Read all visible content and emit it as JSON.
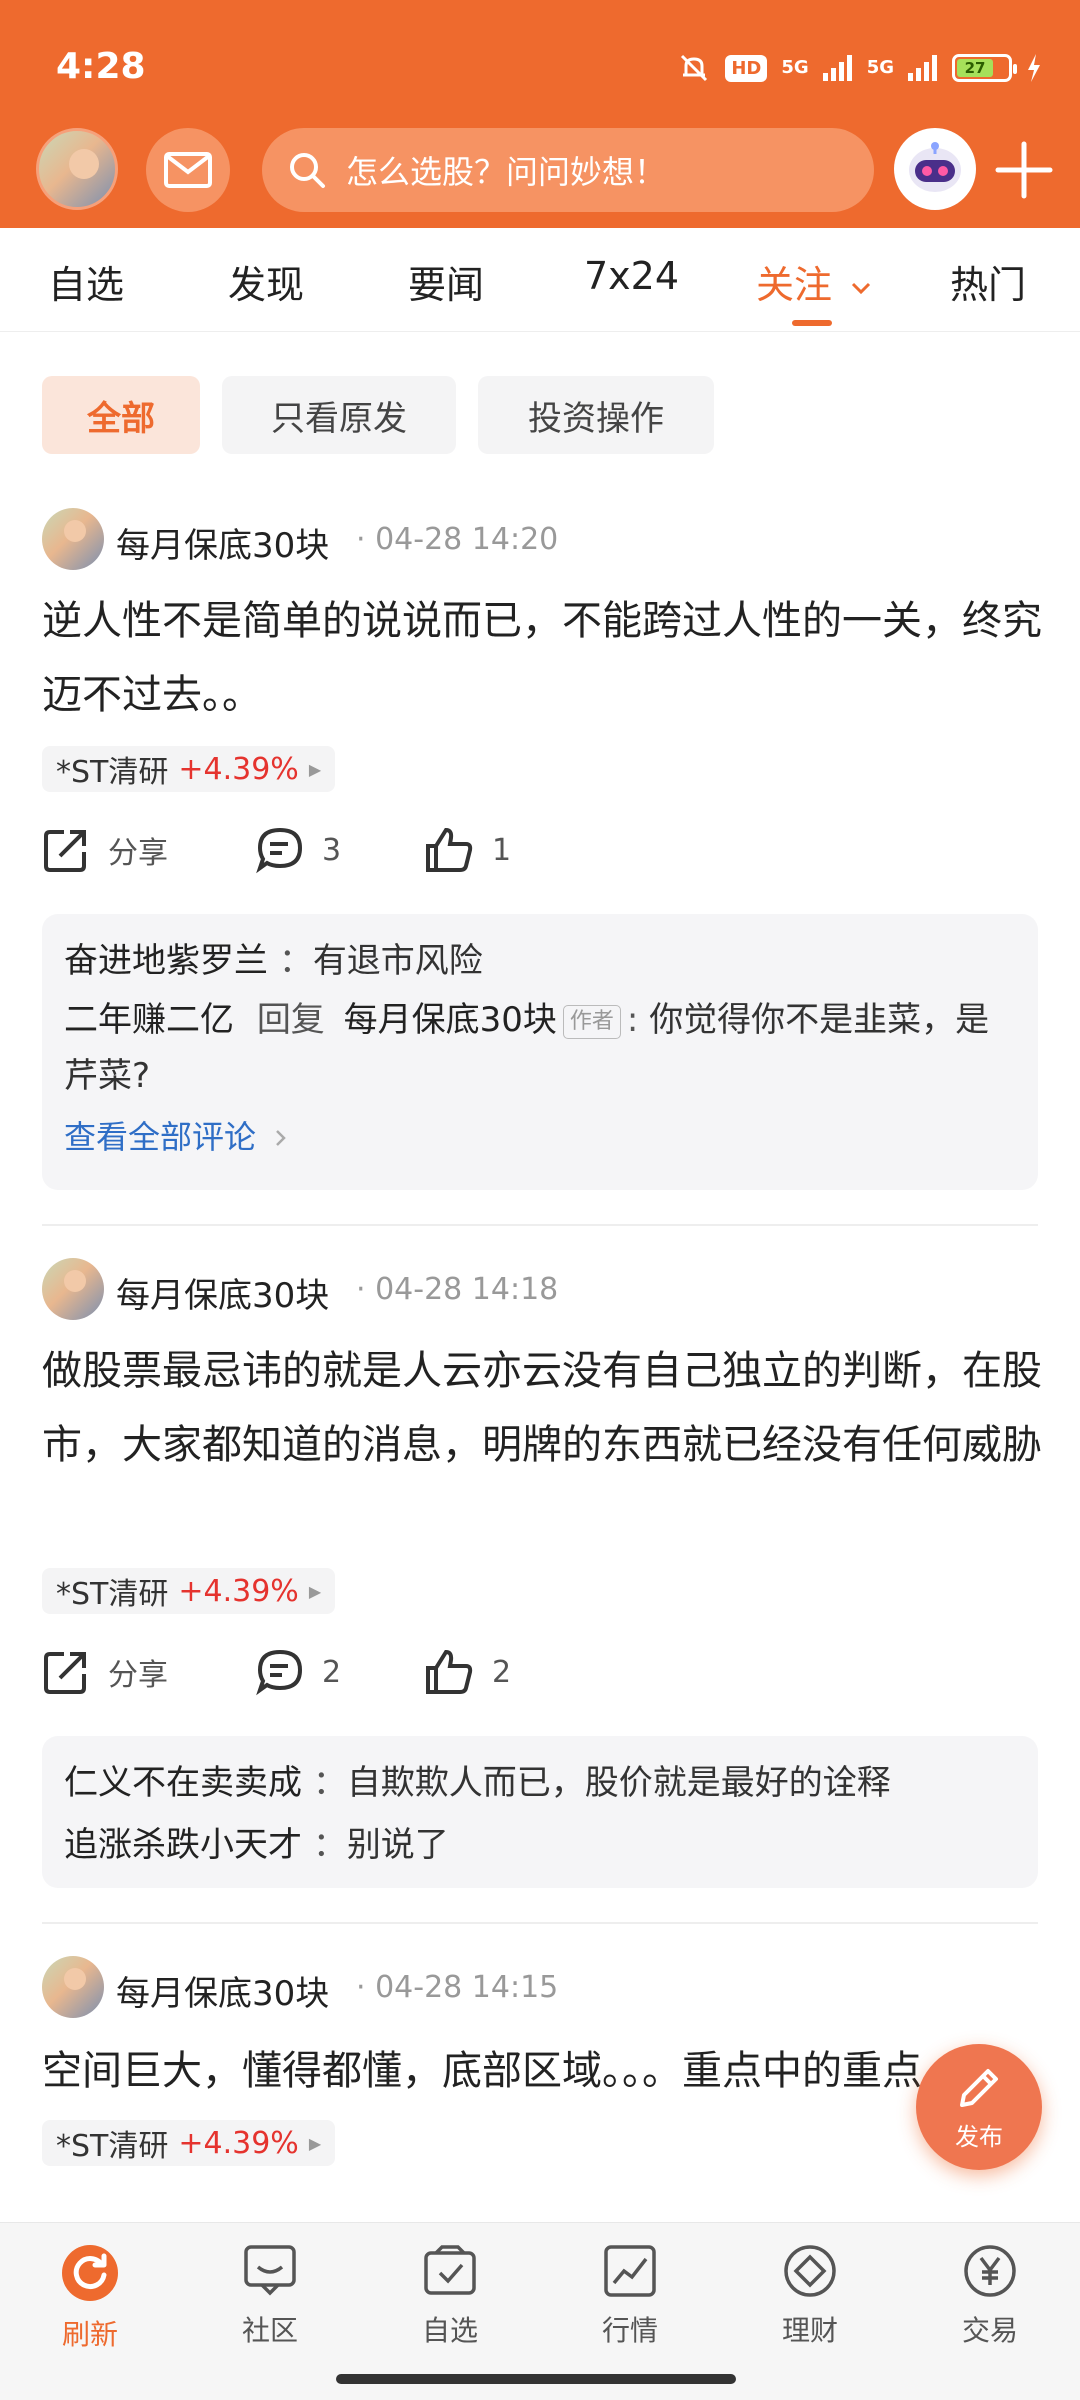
{
  "status": {
    "time": "4:28",
    "signal1": "5G",
    "signal2": "5G",
    "hd": "HD",
    "battery": "27"
  },
  "header": {
    "search_placeholder": "怎么选股？问问妙想！"
  },
  "tabs": [
    {
      "label": "自选"
    },
    {
      "label": "发现"
    },
    {
      "label": "要闻"
    },
    {
      "label": "7x24"
    },
    {
      "label": "关注"
    },
    {
      "label": "热门"
    }
  ],
  "filters": [
    {
      "label": "全部",
      "active": true
    },
    {
      "label": "只看原发"
    },
    {
      "label": "投资操作"
    }
  ],
  "posts": [
    {
      "author": "每月保底30块",
      "time": "04-28 14:20",
      "text": "逆人性不是简单的说说而已，不能跨过人性的一关，终究迈不过去。。",
      "stock": {
        "name": "*ST清研",
        "change": "+4.39%"
      },
      "share_label": "分享",
      "comments": "3",
      "likes": "1",
      "replies": [
        {
          "user": "奋进地紫罗兰",
          "text": "有退市风险"
        },
        {
          "user": "二年赚二亿",
          "reply_word": "回复",
          "reply_to": "每月保底30块",
          "tag": "作者",
          "text": "你觉得你不是韭菜，是芹菜?"
        }
      ],
      "view_all": "查看全部评论"
    },
    {
      "author": "每月保底30块",
      "time": "04-28 14:18",
      "text": "做股票最忌讳的就是人云亦云没有自己独立的判断，在股市，大家都知道的消息，明牌的东西就已经没有任何威胁",
      "stock": {
        "name": "*ST清研",
        "change": "+4.39%"
      },
      "share_label": "分享",
      "comments": "2",
      "likes": "2",
      "replies": [
        {
          "user": "仁义不在卖卖成",
          "text": "自欺欺人而已，股价就是最好的诠释"
        },
        {
          "user": "追涨杀跌小天才",
          "text": "别说了"
        }
      ]
    },
    {
      "author": "每月保底30块",
      "time": "04-28 14:15",
      "text": "空间巨大，懂得都懂，底部区域。。。重点中的重点",
      "stock": {
        "name": "*ST清研",
        "change": "+4.39%"
      }
    }
  ],
  "fab": {
    "label": "发布"
  },
  "bottom_nav": [
    {
      "label": "刷新"
    },
    {
      "label": "社区"
    },
    {
      "label": "自选"
    },
    {
      "label": "行情"
    },
    {
      "label": "理财"
    },
    {
      "label": "交易"
    }
  ],
  "colors": {
    "brand": "#ee6a2e",
    "rise": "#e5332e",
    "link": "#2f6ec6"
  }
}
